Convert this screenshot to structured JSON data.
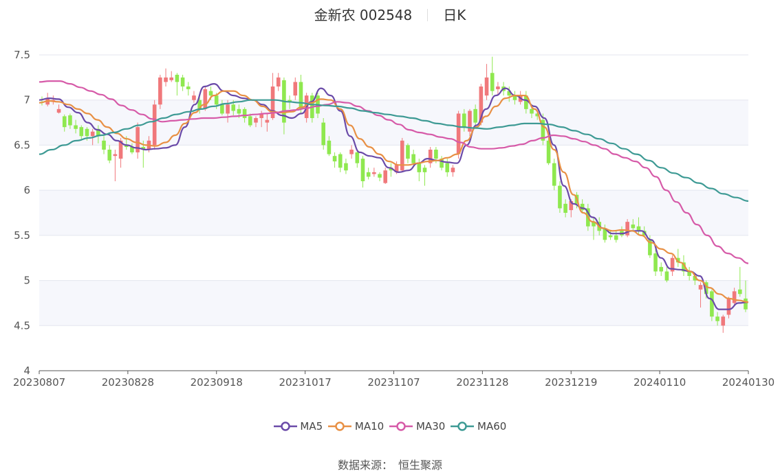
{
  "header": {
    "name": "金新农 002548",
    "period": "日K"
  },
  "source": {
    "label": "数据来源：",
    "value": "恒生聚源"
  },
  "colors": {
    "up": "#f0787b",
    "down": "#8fe84f",
    "MA5": "#6a4aa8",
    "MA10": "#e89044",
    "MA30": "#d65aa8",
    "MA60": "#3d9a94",
    "grid": "#e3e6ef",
    "band": "#f6f7fc"
  },
  "chart_data": {
    "type": "candlestick",
    "title": "金新农 002548 日K",
    "ylim": [
      4,
      7.5
    ],
    "yticks": [
      "4",
      "4.5",
      "5",
      "5.5",
      "6",
      "6.5",
      "7",
      "7.5"
    ],
    "xticks": [
      "20230807",
      "20230828",
      "20230918",
      "20231017",
      "20231107",
      "20231128",
      "20231219",
      "20240110",
      "20240130"
    ],
    "legend": [
      "MA5",
      "MA10",
      "MA30",
      "MA60"
    ],
    "legend_position": "bottom",
    "candles": [
      {
        "o": 6.98,
        "c": 6.97,
        "h": 7.04,
        "l": 6.94
      },
      {
        "o": 6.95,
        "c": 7.02,
        "h": 7.08,
        "l": 6.93
      },
      {
        "o": 6.98,
        "c": 7.0,
        "h": 7.05,
        "l": 6.95
      },
      {
        "o": 6.86,
        "c": 6.9,
        "h": 6.95,
        "l": 6.85
      },
      {
        "o": 6.82,
        "c": 6.7,
        "h": 6.84,
        "l": 6.65
      },
      {
        "o": 6.83,
        "c": 6.72,
        "h": 6.85,
        "l": 6.68
      },
      {
        "o": 6.72,
        "c": 6.68,
        "h": 6.78,
        "l": 6.63
      },
      {
        "o": 6.7,
        "c": 6.6,
        "h": 6.72,
        "l": 6.55
      },
      {
        "o": 6.68,
        "c": 6.6,
        "h": 6.7,
        "l": 6.55
      },
      {
        "o": 6.6,
        "c": 6.65,
        "h": 6.68,
        "l": 6.5
      },
      {
        "o": 6.68,
        "c": 6.6,
        "h": 6.72,
        "l": 6.52
      },
      {
        "o": 6.55,
        "c": 6.45,
        "h": 6.6,
        "l": 6.4
      },
      {
        "o": 6.45,
        "c": 6.33,
        "h": 6.5,
        "l": 6.3
      },
      {
        "o": 6.38,
        "c": 6.4,
        "h": 6.45,
        "l": 6.1
      },
      {
        "o": 6.35,
        "c": 6.55,
        "h": 6.58,
        "l": 6.25
      },
      {
        "o": 6.5,
        "c": 6.48,
        "h": 6.6,
        "l": 6.45
      },
      {
        "o": 6.48,
        "c": 6.42,
        "h": 6.52,
        "l": 6.4
      },
      {
        "o": 6.42,
        "c": 6.7,
        "h": 6.75,
        "l": 6.35
      },
      {
        "o": 6.48,
        "c": 6.45,
        "h": 6.55,
        "l": 6.25
      },
      {
        "o": 6.45,
        "c": 6.55,
        "h": 6.6,
        "l": 6.42
      },
      {
        "o": 6.5,
        "c": 6.95,
        "h": 7.0,
        "l": 6.45
      },
      {
        "o": 6.95,
        "c": 7.25,
        "h": 7.28,
        "l": 6.9
      },
      {
        "o": 7.2,
        "c": 7.25,
        "h": 7.35,
        "l": 7.15
      },
      {
        "o": 7.22,
        "c": 7.25,
        "h": 7.32,
        "l": 7.2
      },
      {
        "o": 7.28,
        "c": 7.2,
        "h": 7.3,
        "l": 7.05
      },
      {
        "o": 7.25,
        "c": 7.15,
        "h": 7.28,
        "l": 7.1
      },
      {
        "o": 7.15,
        "c": 7.12,
        "h": 7.2,
        "l": 7.05
      },
      {
        "o": 7.0,
        "c": 7.05,
        "h": 7.1,
        "l": 6.97
      },
      {
        "o": 7.0,
        "c": 6.9,
        "h": 7.05,
        "l": 6.85
      },
      {
        "o": 6.9,
        "c": 7.12,
        "h": 7.15,
        "l": 6.88
      },
      {
        "o": 7.1,
        "c": 7.05,
        "h": 7.15,
        "l": 7.0
      },
      {
        "o": 7.05,
        "c": 6.95,
        "h": 7.08,
        "l": 6.9
      },
      {
        "o": 6.95,
        "c": 6.85,
        "h": 7.0,
        "l": 6.83
      },
      {
        "o": 6.85,
        "c": 6.95,
        "h": 7.0,
        "l": 6.75
      },
      {
        "o": 6.95,
        "c": 6.88,
        "h": 7.0,
        "l": 6.83
      },
      {
        "o": 6.9,
        "c": 6.85,
        "h": 6.95,
        "l": 6.8
      },
      {
        "o": 6.9,
        "c": 6.8,
        "h": 6.92,
        "l": 6.75
      },
      {
        "o": 6.82,
        "c": 6.72,
        "h": 6.85,
        "l": 6.7
      },
      {
        "o": 6.75,
        "c": 6.8,
        "h": 6.82,
        "l": 6.7
      },
      {
        "o": 6.8,
        "c": 6.85,
        "h": 6.88,
        "l": 6.7
      },
      {
        "o": 6.75,
        "c": 6.78,
        "h": 6.85,
        "l": 6.65
      },
      {
        "o": 6.8,
        "c": 7.15,
        "h": 7.3,
        "l": 6.78
      },
      {
        "o": 7.15,
        "c": 7.25,
        "h": 7.3,
        "l": 7.1
      },
      {
        "o": 7.22,
        "c": 6.75,
        "h": 7.25,
        "l": 6.62
      },
      {
        "o": 7.0,
        "c": 6.98,
        "h": 7.05,
        "l": 6.9
      },
      {
        "o": 7.05,
        "c": 7.2,
        "h": 7.25,
        "l": 7.0
      },
      {
        "o": 7.2,
        "c": 6.9,
        "h": 7.28,
        "l": 6.85
      },
      {
        "o": 6.8,
        "c": 7.05,
        "h": 7.08,
        "l": 6.75
      },
      {
        "o": 7.05,
        "c": 6.8,
        "h": 7.08,
        "l": 6.75
      },
      {
        "o": 7.05,
        "c": 6.85,
        "h": 7.08,
        "l": 6.8
      },
      {
        "o": 6.75,
        "c": 6.5,
        "h": 6.8,
        "l": 6.45
      },
      {
        "o": 6.55,
        "c": 6.4,
        "h": 6.6,
        "l": 6.38
      },
      {
        "o": 6.38,
        "c": 6.32,
        "h": 6.42,
        "l": 6.25
      },
      {
        "o": 6.4,
        "c": 6.25,
        "h": 6.42,
        "l": 6.2
      },
      {
        "o": 6.3,
        "c": 6.22,
        "h": 6.35,
        "l": 6.18
      },
      {
        "o": 6.4,
        "c": 6.45,
        "h": 6.5,
        "l": 6.35
      },
      {
        "o": 6.42,
        "c": 6.3,
        "h": 6.45,
        "l": 6.25
      },
      {
        "o": 6.35,
        "c": 6.1,
        "h": 6.38,
        "l": 6.03
      },
      {
        "o": 6.2,
        "c": 6.15,
        "h": 6.25,
        "l": 6.12
      },
      {
        "o": 6.18,
        "c": 6.2,
        "h": 6.25,
        "l": 6.15
      },
      {
        "o": 6.18,
        "c": 6.14,
        "h": 6.2,
        "l": 6.1
      },
      {
        "o": 6.08,
        "c": 6.22,
        "h": 6.25,
        "l": 6.07
      },
      {
        "o": 6.25,
        "c": 6.22,
        "h": 6.3,
        "l": 6.15
      },
      {
        "o": 6.2,
        "c": 6.28,
        "h": 6.32,
        "l": 6.18
      },
      {
        "o": 6.22,
        "c": 6.55,
        "h": 6.58,
        "l": 6.2
      },
      {
        "o": 6.5,
        "c": 6.35,
        "h": 6.52,
        "l": 6.3
      },
      {
        "o": 6.4,
        "c": 6.3,
        "h": 6.45,
        "l": 6.28
      },
      {
        "o": 6.3,
        "c": 6.2,
        "h": 6.35,
        "l": 6.1
      },
      {
        "o": 6.25,
        "c": 6.2,
        "h": 6.28,
        "l": 6.05
      },
      {
        "o": 6.3,
        "c": 6.45,
        "h": 6.48,
        "l": 6.25
      },
      {
        "o": 6.45,
        "c": 6.35,
        "h": 6.48,
        "l": 6.3
      },
      {
        "o": 6.35,
        "c": 6.25,
        "h": 6.38,
        "l": 6.22
      },
      {
        "o": 6.3,
        "c": 6.2,
        "h": 6.35,
        "l": 6.15
      },
      {
        "o": 6.2,
        "c": 6.25,
        "h": 6.28,
        "l": 6.15
      },
      {
        "o": 6.4,
        "c": 6.85,
        "h": 6.88,
        "l": 6.35
      },
      {
        "o": 6.85,
        "c": 6.7,
        "h": 6.9,
        "l": 6.65
      },
      {
        "o": 6.65,
        "c": 6.88,
        "h": 6.9,
        "l": 6.6
      },
      {
        "o": 6.9,
        "c": 6.75,
        "h": 6.95,
        "l": 6.7
      },
      {
        "o": 6.75,
        "c": 7.15,
        "h": 7.18,
        "l": 6.72
      },
      {
        "o": 7.05,
        "c": 7.25,
        "h": 7.4,
        "l": 7.0
      },
      {
        "o": 7.3,
        "c": 7.1,
        "h": 7.48,
        "l": 7.05
      },
      {
        "o": 7.12,
        "c": 7.15,
        "h": 7.2,
        "l": 7.05
      },
      {
        "o": 7.15,
        "c": 7.1,
        "h": 7.2,
        "l": 7.05
      },
      {
        "o": 7.1,
        "c": 7.05,
        "h": 7.15,
        "l": 6.98
      },
      {
        "o": 7.05,
        "c": 7.0,
        "h": 7.1,
        "l": 6.95
      },
      {
        "o": 6.98,
        "c": 7.05,
        "h": 7.1,
        "l": 6.95
      },
      {
        "o": 7.05,
        "c": 6.9,
        "h": 7.1,
        "l": 6.85
      },
      {
        "o": 6.9,
        "c": 6.85,
        "h": 6.95,
        "l": 6.8
      },
      {
        "o": 6.85,
        "c": 6.82,
        "h": 6.88,
        "l": 6.78
      },
      {
        "o": 6.78,
        "c": 6.55,
        "h": 6.85,
        "l": 6.5
      },
      {
        "o": 6.55,
        "c": 6.3,
        "h": 6.58,
        "l": 6.28
      },
      {
        "o": 6.3,
        "c": 6.05,
        "h": 6.35,
        "l": 6.0
      },
      {
        "o": 6.05,
        "c": 5.8,
        "h": 6.1,
        "l": 5.75
      },
      {
        "o": 5.85,
        "c": 5.75,
        "h": 5.9,
        "l": 5.7
      },
      {
        "o": 5.78,
        "c": 5.88,
        "h": 5.9,
        "l": 5.7
      },
      {
        "o": 5.95,
        "c": 5.85,
        "h": 5.98,
        "l": 5.8
      },
      {
        "o": 5.85,
        "c": 5.78,
        "h": 5.9,
        "l": 5.75
      },
      {
        "o": 5.8,
        "c": 5.6,
        "h": 5.85,
        "l": 5.55
      },
      {
        "o": 5.65,
        "c": 5.6,
        "h": 5.7,
        "l": 5.45
      },
      {
        "o": 5.65,
        "c": 5.55,
        "h": 5.7,
        "l": 5.5
      },
      {
        "o": 5.58,
        "c": 5.45,
        "h": 5.62,
        "l": 5.42
      },
      {
        "o": 5.5,
        "c": 5.48,
        "h": 5.55,
        "l": 5.45
      },
      {
        "o": 5.5,
        "c": 5.45,
        "h": 5.55,
        "l": 5.42
      },
      {
        "o": 5.55,
        "c": 5.5,
        "h": 5.6,
        "l": 5.48
      },
      {
        "o": 5.5,
        "c": 5.65,
        "h": 5.68,
        "l": 5.48
      },
      {
        "o": 5.62,
        "c": 5.58,
        "h": 5.68,
        "l": 5.55
      },
      {
        "o": 5.6,
        "c": 5.55,
        "h": 5.7,
        "l": 5.5
      },
      {
        "o": 5.55,
        "c": 5.5,
        "h": 5.6,
        "l": 5.48
      },
      {
        "o": 5.45,
        "c": 5.28,
        "h": 5.5,
        "l": 5.25
      },
      {
        "o": 5.3,
        "c": 5.1,
        "h": 5.35,
        "l": 5.05
      },
      {
        "o": 5.15,
        "c": 5.1,
        "h": 5.2,
        "l": 5.05
      },
      {
        "o": 5.1,
        "c": 5.0,
        "h": 5.15,
        "l": 4.98
      },
      {
        "o": 5.1,
        "c": 5.25,
        "h": 5.28,
        "l": 5.05
      },
      {
        "o": 5.25,
        "c": 5.2,
        "h": 5.35,
        "l": 5.15
      },
      {
        "o": 5.2,
        "c": 5.1,
        "h": 5.28,
        "l": 5.05
      },
      {
        "o": 5.1,
        "c": 5.05,
        "h": 5.15,
        "l": 5.0
      },
      {
        "o": 5.05,
        "c": 5.0,
        "h": 5.08,
        "l": 4.95
      },
      {
        "o": 4.9,
        "c": 4.95,
        "h": 4.98,
        "l": 4.7
      },
      {
        "o": 4.98,
        "c": 4.85,
        "h": 5.0,
        "l": 4.8
      },
      {
        "o": 4.88,
        "c": 4.6,
        "h": 4.9,
        "l": 4.55
      },
      {
        "o": 4.6,
        "c": 4.55,
        "h": 4.65,
        "l": 4.5
      },
      {
        "o": 4.5,
        "c": 4.6,
        "h": 4.62,
        "l": 4.42
      },
      {
        "o": 4.62,
        "c": 4.8,
        "h": 4.82,
        "l": 4.58
      },
      {
        "o": 4.75,
        "c": 4.88,
        "h": 4.92,
        "l": 4.72
      },
      {
        "o": 4.9,
        "c": 4.85,
        "h": 5.15,
        "l": 4.82
      },
      {
        "o": 4.8,
        "c": 4.68,
        "h": 5.0,
        "l": 4.65
      }
    ],
    "ma_series": [
      {
        "name": "MA5",
        "values": [
          7.0,
          7.02,
          7.01,
          6.92,
          6.86,
          6.75,
          6.67,
          6.62,
          6.55,
          6.5,
          6.47,
          6.45,
          6.46,
          6.47,
          6.5,
          6.7,
          6.95,
          7.15,
          7.18,
          7.1,
          7.05,
          7.02,
          7.0,
          6.95,
          6.88,
          6.83,
          6.8,
          6.85,
          6.98,
          7.13,
          7.05,
          6.88,
          6.6,
          6.42,
          6.38,
          6.36,
          6.25,
          6.2,
          6.22,
          6.3,
          6.35,
          6.33,
          6.31,
          6.3,
          6.5,
          6.72,
          6.9,
          7.05,
          7.13,
          7.05,
          7.0,
          6.93,
          6.8,
          6.5,
          6.05,
          5.85,
          5.8,
          5.7,
          5.58,
          5.52,
          5.52,
          5.55,
          5.55,
          5.45,
          5.25,
          5.13,
          5.12,
          5.1,
          5.05,
          4.8,
          4.68,
          4.68,
          4.75,
          4.76
        ]
      },
      {
        "name": "MA10",
        "values": [
          6.97,
          6.99,
          6.98,
          6.95,
          6.9,
          6.85,
          6.78,
          6.7,
          6.63,
          6.57,
          6.53,
          6.5,
          6.49,
          6.53,
          6.61,
          6.74,
          6.86,
          6.95,
          7.05,
          7.1,
          7.1,
          7.05,
          7.0,
          6.93,
          6.87,
          6.86,
          6.87,
          6.92,
          6.97,
          7.01,
          7.0,
          6.9,
          6.72,
          6.57,
          6.48,
          6.4,
          6.32,
          6.28,
          6.28,
          6.3,
          6.32,
          6.33,
          6.36,
          6.4,
          6.55,
          6.7,
          6.82,
          6.93,
          7.02,
          7.05,
          7.05,
          6.9,
          6.7,
          6.45,
          6.2,
          5.95,
          5.75,
          5.65,
          5.58,
          5.55,
          5.56,
          5.55,
          5.5,
          5.42,
          5.35,
          5.3,
          5.2,
          5.1,
          5.0,
          4.92,
          4.85,
          4.8,
          4.78,
          4.76
        ]
      },
      {
        "name": "MA30",
        "values": [
          7.2,
          7.21,
          7.21,
          7.18,
          7.14,
          7.1,
          7.06,
          7.01,
          6.94,
          6.89,
          6.84,
          6.79,
          6.76,
          6.77,
          6.78,
          6.79,
          6.8,
          6.8,
          6.81,
          6.82,
          6.83,
          6.84,
          6.85,
          6.86,
          6.88,
          6.89,
          6.91,
          6.93,
          6.95,
          6.98,
          6.97,
          6.93,
          6.88,
          6.83,
          6.78,
          6.73,
          6.67,
          6.64,
          6.62,
          6.59,
          6.57,
          6.53,
          6.48,
          6.46,
          6.46,
          6.47,
          6.49,
          6.51,
          6.55,
          6.58,
          6.61,
          6.6,
          6.57,
          6.54,
          6.5,
          6.46,
          6.4,
          6.36,
          6.32,
          6.25,
          6.15,
          6.0,
          5.87,
          5.75,
          5.62,
          5.5,
          5.38,
          5.3,
          5.25,
          5.19
        ]
      },
      {
        "name": "MA60",
        "values": [
          6.4,
          6.45,
          6.5,
          6.55,
          6.58,
          6.61,
          6.64,
          6.68,
          6.72,
          6.76,
          6.8,
          6.84,
          6.87,
          6.9,
          6.93,
          6.96,
          6.98,
          7.0,
          7.0,
          7.0,
          6.98,
          6.97,
          6.95,
          6.94,
          6.93,
          6.91,
          6.88,
          6.86,
          6.84,
          6.82,
          6.8,
          6.77,
          6.74,
          6.72,
          6.7,
          6.69,
          6.68,
          6.7,
          6.72,
          6.74,
          6.74,
          6.73,
          6.7,
          6.66,
          6.62,
          6.57,
          6.52,
          6.46,
          6.4,
          6.33,
          6.25,
          6.19,
          6.14,
          6.08,
          6.02,
          5.96,
          5.92,
          5.88
        ]
      }
    ]
  }
}
